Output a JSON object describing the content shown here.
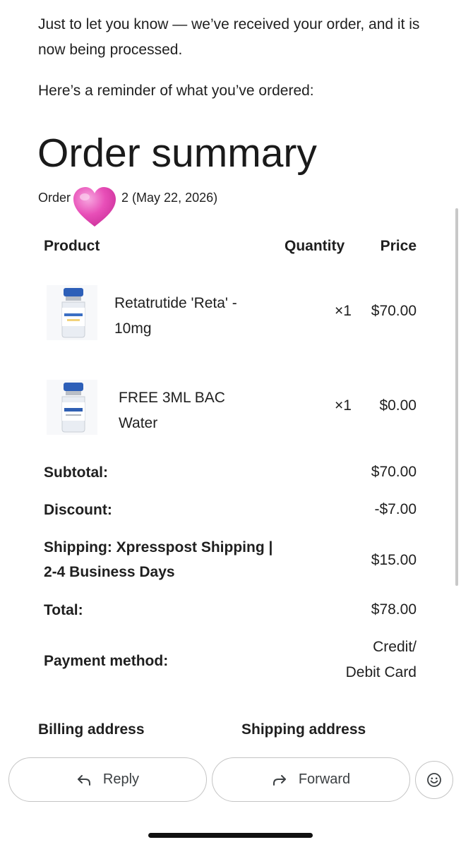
{
  "email": {
    "intro": "Just to let you know — we’ve received your order, and it is now being processed.",
    "reminder": "Here’s a reminder of what you’ve ordered:"
  },
  "order": {
    "title": "Order summary",
    "number_prefix": "Order",
    "number_tail": "2",
    "date": "(May 22, 2026)"
  },
  "table": {
    "headers": {
      "product": "Product",
      "quantity": "Quantity",
      "price": "Price"
    },
    "items": [
      {
        "name_line1": "Retatrutide 'Reta' -",
        "name_line2": "10mg",
        "quantity": "×1",
        "price": "$70.00",
        "image_icon": "retatrutide-vial-image",
        "label_color": "#3b6fc4"
      },
      {
        "name_line1": "FREE 3ML BAC",
        "name_line2": "Water",
        "quantity": "×1",
        "price": "$0.00",
        "image_icon": "bac-water-vial-image",
        "label_color": "#2f5fb3"
      }
    ]
  },
  "totals": {
    "subtotal_label": "Subtotal:",
    "subtotal": "$70.00",
    "discount_label": "Discount:",
    "discount": "-$7.00",
    "shipping_label_line1": "Shipping: Xpresspost Shipping |",
    "shipping_label_line2": "2-4 Business Days",
    "shipping": "$15.00",
    "total_label": "Total:",
    "total": "$78.00",
    "payment_label": "Payment method:",
    "payment_line1": "Credit/",
    "payment_line2": "Debit Card"
  },
  "addresses": {
    "billing": "Billing address",
    "shipping": "Shipping address"
  },
  "actions": {
    "reply": "Reply",
    "forward": "Forward",
    "emoji_icon": "smiley-icon"
  },
  "decoration": {
    "sticker_icon": "pink-heart-emoji",
    "heart_color": "#e84fb8"
  }
}
